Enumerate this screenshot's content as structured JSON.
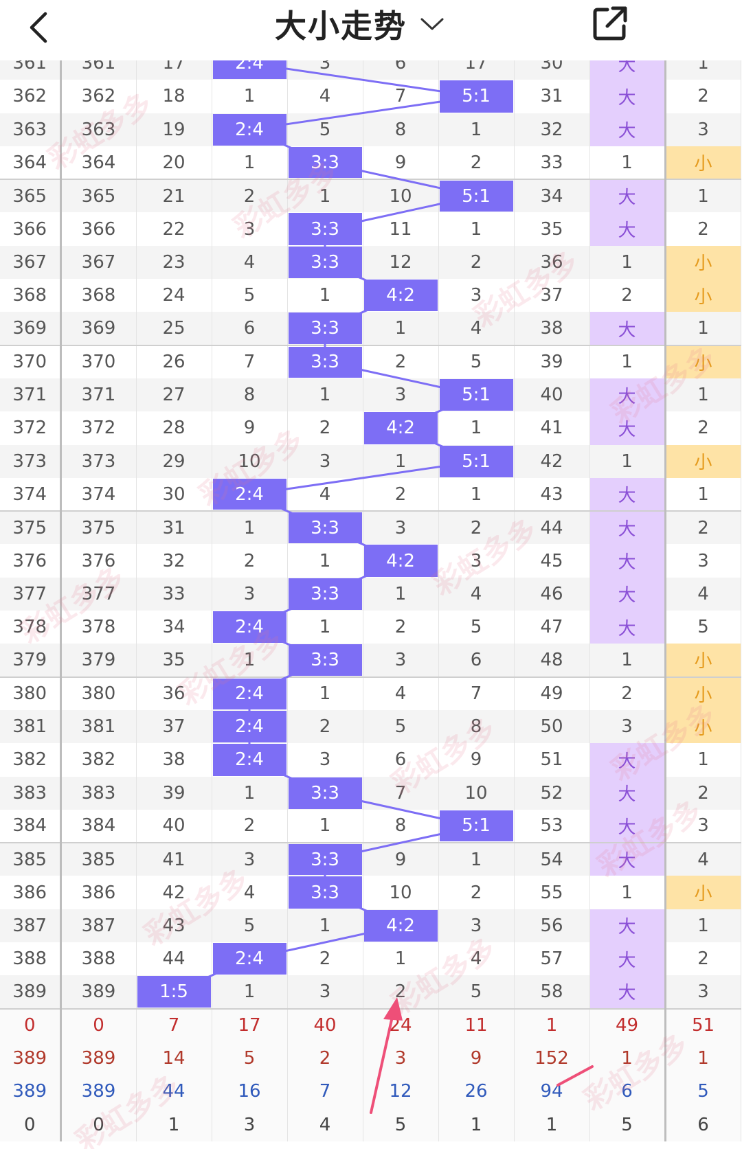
{
  "header": {
    "title": "大小走势"
  },
  "rows": [
    [
      "361",
      "361",
      "17",
      "2:4",
      "3",
      "6",
      "17",
      "30",
      "大",
      "1"
    ],
    [
      "362",
      "362",
      "18",
      "1",
      "4",
      "7",
      "5:1",
      "31",
      "大",
      "2"
    ],
    [
      "363",
      "363",
      "19",
      "2:4",
      "5",
      "8",
      "1",
      "32",
      "大",
      "3"
    ],
    [
      "364",
      "364",
      "20",
      "1",
      "3:3",
      "9",
      "2",
      "33",
      "1",
      "小"
    ],
    [
      "365",
      "365",
      "21",
      "2",
      "1",
      "10",
      "5:1",
      "34",
      "大",
      "1"
    ],
    [
      "366",
      "366",
      "22",
      "3",
      "3:3",
      "11",
      "1",
      "35",
      "大",
      "2"
    ],
    [
      "367",
      "367",
      "23",
      "4",
      "3:3",
      "12",
      "2",
      "36",
      "1",
      "小"
    ],
    [
      "368",
      "368",
      "24",
      "5",
      "1",
      "4:2",
      "3",
      "37",
      "2",
      "小"
    ],
    [
      "369",
      "369",
      "25",
      "6",
      "3:3",
      "1",
      "4",
      "38",
      "大",
      "1"
    ],
    [
      "370",
      "370",
      "26",
      "7",
      "3:3",
      "2",
      "5",
      "39",
      "1",
      "小"
    ],
    [
      "371",
      "371",
      "27",
      "8",
      "1",
      "3",
      "5:1",
      "40",
      "大",
      "1"
    ],
    [
      "372",
      "372",
      "28",
      "9",
      "2",
      "4:2",
      "1",
      "41",
      "大",
      "2"
    ],
    [
      "373",
      "373",
      "29",
      "10",
      "3",
      "1",
      "5:1",
      "42",
      "1",
      "小"
    ],
    [
      "374",
      "374",
      "30",
      "2:4",
      "4",
      "2",
      "1",
      "43",
      "大",
      "1"
    ],
    [
      "375",
      "375",
      "31",
      "1",
      "3:3",
      "3",
      "2",
      "44",
      "大",
      "2"
    ],
    [
      "376",
      "376",
      "32",
      "2",
      "1",
      "4:2",
      "3",
      "45",
      "大",
      "3"
    ],
    [
      "377",
      "377",
      "33",
      "3",
      "3:3",
      "1",
      "4",
      "46",
      "大",
      "4"
    ],
    [
      "378",
      "378",
      "34",
      "2:4",
      "1",
      "2",
      "5",
      "47",
      "大",
      "5"
    ],
    [
      "379",
      "379",
      "35",
      "1",
      "3:3",
      "3",
      "6",
      "48",
      "1",
      "小"
    ],
    [
      "380",
      "380",
      "36",
      "2:4",
      "1",
      "4",
      "7",
      "49",
      "2",
      "小"
    ],
    [
      "381",
      "381",
      "37",
      "2:4",
      "2",
      "5",
      "8",
      "50",
      "3",
      "小"
    ],
    [
      "382",
      "382",
      "38",
      "2:4",
      "3",
      "6",
      "9",
      "51",
      "大",
      "1"
    ],
    [
      "383",
      "383",
      "39",
      "1",
      "3:3",
      "7",
      "10",
      "52",
      "大",
      "2"
    ],
    [
      "384",
      "384",
      "40",
      "2",
      "1",
      "8",
      "5:1",
      "53",
      "大",
      "3"
    ],
    [
      "385",
      "385",
      "41",
      "3",
      "3:3",
      "9",
      "1",
      "54",
      "大",
      "4"
    ],
    [
      "386",
      "386",
      "42",
      "4",
      "3:3",
      "10",
      "2",
      "55",
      "1",
      "小"
    ],
    [
      "387",
      "387",
      "43",
      "5",
      "1",
      "4:2",
      "3",
      "56",
      "大",
      "1"
    ],
    [
      "388",
      "388",
      "44",
      "2:4",
      "2",
      "1",
      "4",
      "57",
      "大",
      "2"
    ],
    [
      "389",
      "389",
      "1:5",
      "1",
      "3",
      "2",
      "5",
      "58",
      "大",
      "3"
    ]
  ],
  "stats": [
    [
      "0",
      "0",
      "7",
      "17",
      "40",
      "24",
      "11",
      "1",
      "49",
      "51"
    ],
    [
      "389",
      "389",
      "14",
      "5",
      "2",
      "3",
      "9",
      "152",
      "1",
      "1"
    ],
    [
      "389",
      "389",
      "44",
      "16",
      "7",
      "12",
      "26",
      "94",
      "6",
      "5"
    ],
    [
      "0",
      "0",
      "1",
      "3",
      "4",
      "5",
      "1",
      "1",
      "5",
      "6"
    ]
  ],
  "colors": {
    "highlight": "#7d6ef5",
    "big": "#e4cffd",
    "small": "#fee3a6",
    "arrow": "#ee4f78"
  },
  "watermark": "彩虹多多"
}
